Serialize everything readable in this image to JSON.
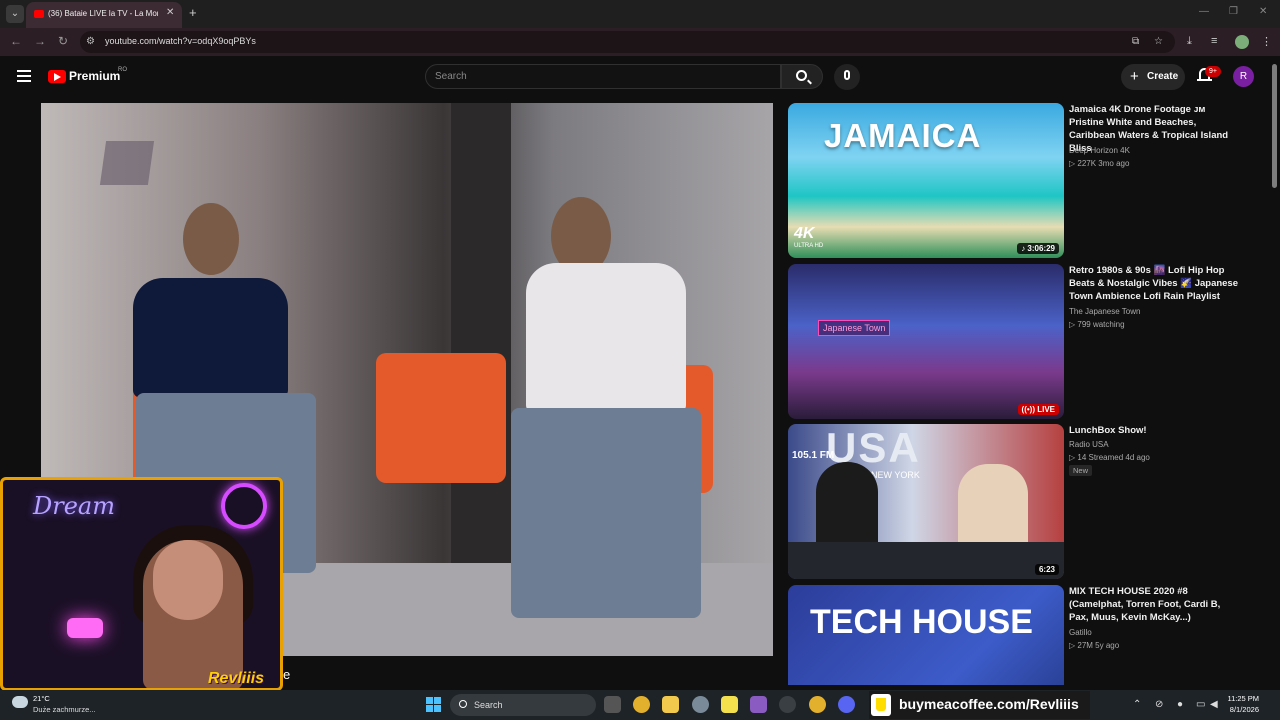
{
  "browser": {
    "tab_title": "(36) Bataie LIVE la TV - La Mon",
    "url": "youtube.com/watch?v=odqX9oqPBYs"
  },
  "header": {
    "brand": "Premium",
    "region": "RO",
    "search_placeholder": "Search",
    "create_label": "Create",
    "notifications": "9+",
    "avatar_letter": "R"
  },
  "webcam": {
    "neon_text": "Dream",
    "tag": "Revliiis"
  },
  "subtitle_fragment": "e",
  "recommendations": [
    {
      "title": "Jamaica 4K Drone Footage ᴊᴍ Pristine White and Beaches, Caribbean Waters & Tropical Island Bliss",
      "channel": "Deep Horizon 4K",
      "meta": "▷ 227K  3mo ago",
      "duration": "♪ 3:06:29",
      "thumb_text": "JAMAICA",
      "thumb_badge": "4K",
      "thumb_sub": "ULTRA HD"
    },
    {
      "title": "Retro 1980s & 90s 🌆 Lofi Hip Hop Beats & Nostalgic Vibes 🌠 Japanese Town Ambience Lofi Rain Playlist",
      "channel": "The Japanese Town",
      "meta": "▷ 799 watching",
      "duration": "((•)) LIVE",
      "thumb_text": "Japanese Town"
    },
    {
      "title": "LunchBox Show!",
      "channel": "Radio USA",
      "meta": "▷ 14  Streamed 4d ago",
      "badge": "New",
      "duration": "6:23",
      "thumb_text": "USA",
      "thumb_sub": "NEW YORK",
      "thumb_freq": "105.1 FM"
    },
    {
      "title": "MIX TECH HOUSE 2020 #8 (Camelphat, Torren Foot, Cardi B, Pax, Muus, Kevin McKay...)",
      "channel": "Gatillo",
      "meta": "▷ 27M  5y ago",
      "thumb_text": "TECH HOUSE"
    }
  ],
  "taskbar": {
    "temperature": "21°C",
    "weather": "Duże zachmurze...",
    "search_label": "Search",
    "promo": "buymeacoffee.com/Revliiis",
    "time": "11:25 PM",
    "date": "8/1/2026"
  },
  "colors": {
    "accent_red": "#ff0000",
    "live_red": "#cc0000",
    "webcam_border": "#e8a100"
  }
}
